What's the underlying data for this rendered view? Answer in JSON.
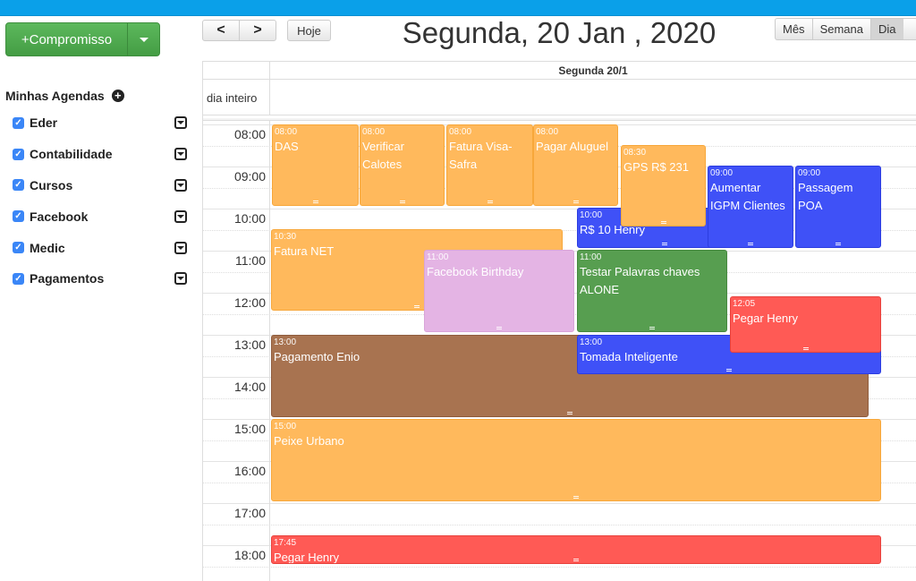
{
  "toolbar": {
    "new_button_label": "+Compromisso",
    "prev_label": "<",
    "next_label": ">",
    "today_label": "Hoje",
    "title": "Segunda, 20 Jan , 2020",
    "views": [
      {
        "label": "Mês",
        "active": false
      },
      {
        "label": "Semana",
        "active": false
      },
      {
        "label": "Dia",
        "active": true
      }
    ]
  },
  "sidebar": {
    "title": "Minhas Agendas",
    "agendas": [
      {
        "label": "Eder",
        "checked": true
      },
      {
        "label": "Contabilidade",
        "checked": true
      },
      {
        "label": "Cursos",
        "checked": true
      },
      {
        "label": "Facebook",
        "checked": true
      },
      {
        "label": "Medic",
        "checked": true
      },
      {
        "label": "Pagamentos",
        "checked": true
      }
    ]
  },
  "calendar": {
    "day_header": "Segunda 20/1",
    "allday_label": "dia inteiro",
    "hours": [
      "08:00",
      "09:00",
      "10:00",
      "11:00",
      "12:00",
      "13:00",
      "14:00",
      "15:00",
      "16:00",
      "17:00",
      "18:00"
    ],
    "events": [
      {
        "time": "08:00",
        "title": "DAS",
        "color": "orange"
      },
      {
        "time": "08:00",
        "title": "Verificar Calotes",
        "color": "orange"
      },
      {
        "time": "08:00",
        "title": "Fatura Visa-Safra",
        "color": "orange"
      },
      {
        "time": "08:00",
        "title": "Pagar Aluguel",
        "color": "orange"
      },
      {
        "time": "10:00",
        "title": "R$ 10 Henry",
        "color": "blue"
      },
      {
        "time": "08:30",
        "title": "GPS R$ 231",
        "color": "orange"
      },
      {
        "time": "09:00",
        "title": "Aumentar IGPM Clientes",
        "color": "blue"
      },
      {
        "time": "09:00",
        "title": "Passagem POA",
        "color": "blue"
      },
      {
        "time": "10:30",
        "title": "Fatura NET",
        "color": "orange"
      },
      {
        "time": "11:00",
        "title": "Facebook Birthday",
        "color": "pink"
      },
      {
        "time": "11:00",
        "title": "Testar Palavras chaves ALONE",
        "color": "green"
      },
      {
        "time": "13:00",
        "title": "Pagamento Enio",
        "color": "brown"
      },
      {
        "time": "13:00",
        "title": "Tomada Inteligente",
        "color": "blue"
      },
      {
        "time": "12:05",
        "title": "Pegar Henry",
        "color": "red"
      },
      {
        "time": "15:00",
        "title": "Peixe Urbano",
        "color": "orange"
      },
      {
        "time": "17:45",
        "title": "Pegar Henry",
        "color": "red"
      }
    ]
  }
}
